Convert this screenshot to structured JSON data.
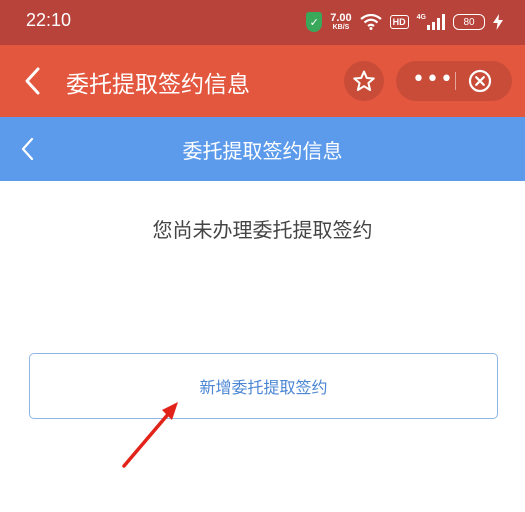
{
  "status_bar": {
    "time": "22:10",
    "shield_icon": "shield-icon",
    "net_speed_value": "7.00",
    "net_speed_unit": "KB/S",
    "hd_label": "HD",
    "signal_label": "4G",
    "battery_level": "80"
  },
  "header": {
    "title": "委托提取签约信息",
    "background": "#e4573f",
    "back_icon": "chevron-left-icon",
    "star_icon": "star-icon",
    "more_icon": "more-icon",
    "close_icon": "close-circle-icon"
  },
  "sub_header": {
    "title": "委托提取签约信息",
    "background": "#5c9bec",
    "back_icon": "chevron-left-icon"
  },
  "main": {
    "notice": "您尚未办理委托提取签约",
    "add_button_label": "新增委托提取签约"
  },
  "annotation": {
    "arrow_color": "#e2231a",
    "arrow_icon": "red-arrow-icon"
  }
}
